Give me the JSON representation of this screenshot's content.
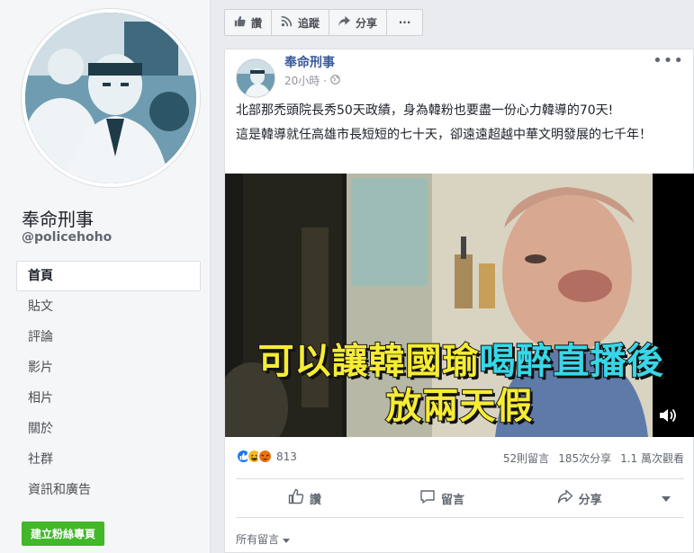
{
  "page": {
    "name": "奉命刑事",
    "handle": "@policehoho"
  },
  "nav": {
    "items": [
      {
        "label": "首頁",
        "active": true
      },
      {
        "label": "貼文"
      },
      {
        "label": "評論"
      },
      {
        "label": "影片"
      },
      {
        "label": "相片"
      },
      {
        "label": "關於"
      },
      {
        "label": "社群"
      },
      {
        "label": "資訊和廣告"
      }
    ],
    "create_label": "建立粉絲專頁"
  },
  "topbar": {
    "like": "讚",
    "follow": "追蹤",
    "share": "分享",
    "more": "···"
  },
  "post": {
    "author": "奉命刑事",
    "time": "20小時",
    "privacy_icon": "globe-icon",
    "body_line1": "北部那禿頭院長秀50天政績，身為韓粉也要盡一份心力韓導的70天!",
    "body_line2": "這是韓導就任高雄市長短短的七十天，卻遠遠超越中華文明發展的七千年！",
    "video": {
      "caption_line1_white": "可以讓韓國瑜",
      "caption_line1_cyan": "喝醉直播後",
      "caption_line2": "放兩天假"
    },
    "reactions": {
      "types": [
        "like",
        "haha",
        "angry"
      ],
      "count": "813"
    },
    "stats": {
      "comments": "52則留言",
      "shares": "185次分享",
      "views": "1.1 萬次觀看"
    },
    "actions": {
      "like": "讚",
      "comment": "留言",
      "share": "分享"
    },
    "comment_filter": "所有留言"
  },
  "colors": {
    "link_blue": "#385898",
    "green_button": "#42b72a",
    "caption_yellow": "#f6ec34",
    "caption_cyan": "#37d7e8"
  }
}
